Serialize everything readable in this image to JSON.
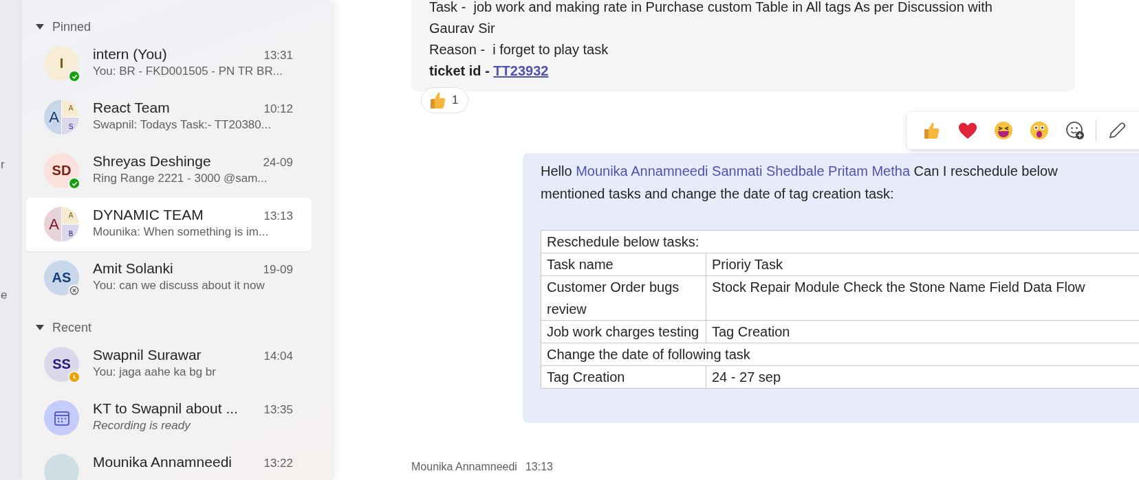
{
  "rail": {
    "fragments": [
      "r",
      "e"
    ]
  },
  "sidebar": {
    "sections": [
      {
        "title": "Pinned",
        "expanded": true,
        "chats": [
          {
            "name": "intern (You)",
            "time": "13:31",
            "preview": "You: BR - FKD001505 - PN TR BR...",
            "selected": false,
            "status": {
              "kind": "available"
            },
            "avatar": {
              "kind": "initials",
              "initials": "I",
              "color": "#f7ecd6"
            }
          },
          {
            "name": "React Team",
            "time": "10:12",
            "preview": "Swapnil: Todays Task:-   TT20380...",
            "selected": false,
            "avatar": {
              "kind": "group",
              "parts": [
                {
                  "initials": "A",
                  "color": "#c9d6ea"
                },
                {
                  "initials": "A",
                  "color": "#f6ebd0"
                },
                {
                  "initials": "S",
                  "color": "#dcd8ec"
                }
              ]
            }
          },
          {
            "name": "Shreyas Deshinge",
            "time": "24-09",
            "preview": "Ring Range 2221 - 3000 @sam...",
            "selected": false,
            "status": {
              "kind": "available"
            },
            "avatar": {
              "kind": "initials",
              "initials": "SD",
              "color": "#fbe0dc"
            }
          },
          {
            "name": "DYNAMIC TEAM",
            "time": "13:13",
            "preview": "Mounika: When something is im...",
            "selected": true,
            "avatar": {
              "kind": "group",
              "parts": [
                {
                  "initials": "A",
                  "color": "#e8d3d8"
                },
                {
                  "initials": "A",
                  "color": "#f6ebd0"
                },
                {
                  "initials": "B",
                  "color": "#dcd8ec"
                }
              ]
            }
          },
          {
            "name": "Amit Solanki",
            "time": "19-09",
            "preview": "You: can we discuss about it now",
            "selected": false,
            "status": {
              "kind": "offline"
            },
            "avatar": {
              "kind": "initials",
              "initials": "AS",
              "color": "#c9d7ea"
            }
          }
        ]
      },
      {
        "title": "Recent",
        "expanded": true,
        "chats": [
          {
            "name": "Swapnil Surawar",
            "time": "14:04",
            "preview": "You: jaga aahe ka bg br",
            "selected": false,
            "status": {
              "kind": "away"
            },
            "avatar": {
              "kind": "initials",
              "initials": "SS",
              "color": "#dcd8ec"
            }
          },
          {
            "name": "KT to Swapnil about ...",
            "time": "13:35",
            "preview": "Recording is ready",
            "preview_italic": true,
            "selected": false,
            "avatar": {
              "kind": "meeting",
              "color": "#c5cbfa"
            }
          },
          {
            "name": "Mounika Annamneedi",
            "time": "13:22",
            "selected": false,
            "avatar": {
              "kind": "initials",
              "color": "#cfdfe3"
            }
          }
        ]
      }
    ]
  },
  "messages": [
    {
      "kind": "text",
      "lines": [
        "Task -  job work and making rate in Purchase custom Table in All tags As per Discussion with Gaurav Sir",
        "Reason -  i forget to play task"
      ],
      "ticket": {
        "label": "ticket id - ",
        "link": "TT23932"
      },
      "reactions": [
        {
          "count": "1"
        }
      ]
    },
    {
      "kind": "table",
      "greeting": "Hello",
      "mentions": [
        "Mounika Annamneedi",
        "Sanmati Shedbale",
        "Pritam Metha"
      ],
      "body": "Can I reschedule below mentioned tasks and change the date of tag creation task:",
      "table": [
        {
          "kind": "span",
          "cells": [
            "Reschedule below tasks:"
          ]
        },
        {
          "kind": "pair",
          "cells": [
            "Task name",
            "Prioriy Task"
          ]
        },
        {
          "kind": "pair",
          "cells": [
            "Customer Order bugs review",
            "Stock Repair Module Check the Stone Name Field Data Flow"
          ]
        },
        {
          "kind": "pair",
          "cells": [
            "Job work charges testing",
            "Tag Creation"
          ]
        },
        {
          "kind": "span",
          "cells": [
            "Change the date of following task"
          ]
        },
        {
          "kind": "pair",
          "cells": [
            "Tag Creation",
            "24 - 27 sep"
          ]
        }
      ]
    }
  ],
  "next_message": {
    "author": "Mounika Annamneedi",
    "time": "13:13"
  }
}
